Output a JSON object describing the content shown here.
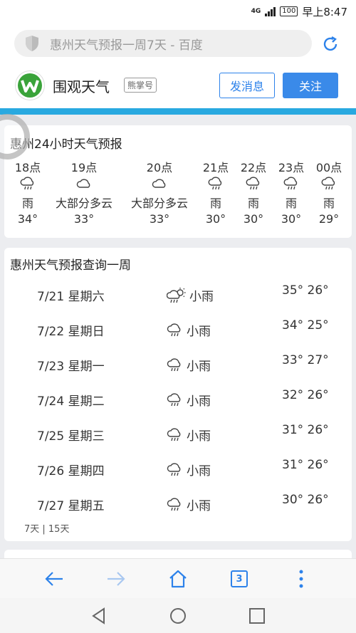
{
  "status": {
    "network": "4G",
    "battery": "100",
    "time": "早上8:47"
  },
  "address_bar": {
    "url_text": "惠州天气预报一周7天 - 百度"
  },
  "account": {
    "name": "围观天气",
    "badge": "熊掌号",
    "message_button": "发消息",
    "follow_button": "关注",
    "accent_color": "#3a8ae9"
  },
  "hourly": {
    "title": "惠州24小时天气预报",
    "items": [
      {
        "time": "18点",
        "icon": "rain-icon",
        "desc": "雨",
        "temp": "34°"
      },
      {
        "time": "19点",
        "icon": "cloudy-icon",
        "desc": "大部分多云",
        "temp": "33°"
      },
      {
        "time": "20点",
        "icon": "cloudy-icon",
        "desc": "大部分多云",
        "temp": "33°"
      },
      {
        "time": "21点",
        "icon": "rain-icon",
        "desc": "雨",
        "temp": "30°"
      },
      {
        "time": "22点",
        "icon": "rain-icon",
        "desc": "雨",
        "temp": "30°"
      },
      {
        "time": "23点",
        "icon": "rain-icon",
        "desc": "雨",
        "temp": "30°"
      },
      {
        "time": "00点",
        "icon": "rain-icon",
        "desc": "雨",
        "temp": "29°"
      }
    ]
  },
  "weekly": {
    "title": "惠州天气预报查询一周",
    "days": [
      {
        "date": "7/21 星期六",
        "icon": "sun-rain-icon",
        "desc": "小雨",
        "temps": "35° 26°"
      },
      {
        "date": "7/22 星期日",
        "icon": "rain-icon",
        "desc": "小雨",
        "temps": "34° 25°"
      },
      {
        "date": "7/23 星期一",
        "icon": "rain-icon",
        "desc": "小雨",
        "temps": "33° 27°"
      },
      {
        "date": "7/24 星期二",
        "icon": "rain-icon",
        "desc": "小雨",
        "temps": "32° 26°"
      },
      {
        "date": "7/25 星期三",
        "icon": "rain-icon",
        "desc": "小雨",
        "temps": "31° 26°"
      },
      {
        "date": "7/26 星期四",
        "icon": "rain-icon",
        "desc": "小雨",
        "temps": "31° 26°"
      },
      {
        "date": "7/27 星期五",
        "icon": "rain-icon",
        "desc": "小雨",
        "temps": "30° 26°"
      }
    ],
    "range_links": "7天 | 15天"
  },
  "toolbar": {
    "tab_count": "3"
  }
}
